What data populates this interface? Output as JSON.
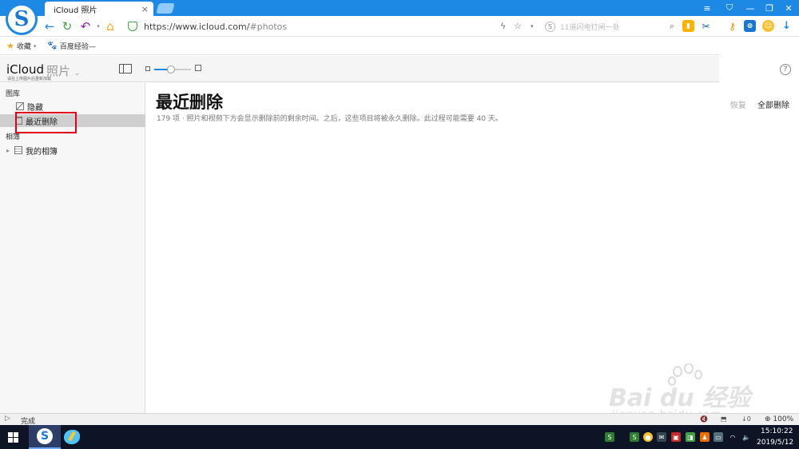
{
  "browser": {
    "tab": {
      "title": "iCloud 照片",
      "close": "×"
    },
    "window_controls": [
      "≡",
      "⛉",
      "—",
      "❐",
      "✕"
    ],
    "address": {
      "scheme_host": "https://www.icloud.com/",
      "fragment": "#photos"
    },
    "search": {
      "placeholder": "11道闪电打闸一处"
    },
    "accent": "#1e88e5",
    "bookmarks": [
      {
        "label": "收藏",
        "icon": "star-icon"
      },
      {
        "label": "百度经验—",
        "icon": "baidu-paw-icon"
      }
    ]
  },
  "icloud": {
    "brand": "iCloud",
    "app_name": "照片",
    "subtitle": "请在上传图片后重新加载",
    "help": "?"
  },
  "sidebar": {
    "library_heading": "图库",
    "items": [
      {
        "label": "隐藏",
        "icon": "hidden-icon"
      },
      {
        "label": "最近删除",
        "icon": "trash-icon"
      }
    ],
    "albums_heading": "相簿",
    "albums": [
      {
        "label": "我的相簿",
        "icon": "album-icon"
      }
    ]
  },
  "main": {
    "title": "最近删除",
    "description": "179 项 · 照片和视频下方会显示删除前的剩余时间。之后，这些项目将被永久删除。此过程可能需要 40 天。",
    "actions": {
      "restore": "恢复",
      "delete_all": "全部删除"
    }
  },
  "statusbar": {
    "status": "完成",
    "zoom": "⊕ 100%",
    "icons": [
      "🔇",
      "⬒",
      "↓0"
    ]
  },
  "taskbar": {
    "time": "15:10:22",
    "date": "2019/5/12"
  },
  "watermark": {
    "main": "Bai du 经验",
    "sub": "jingyan.baidu.com"
  }
}
